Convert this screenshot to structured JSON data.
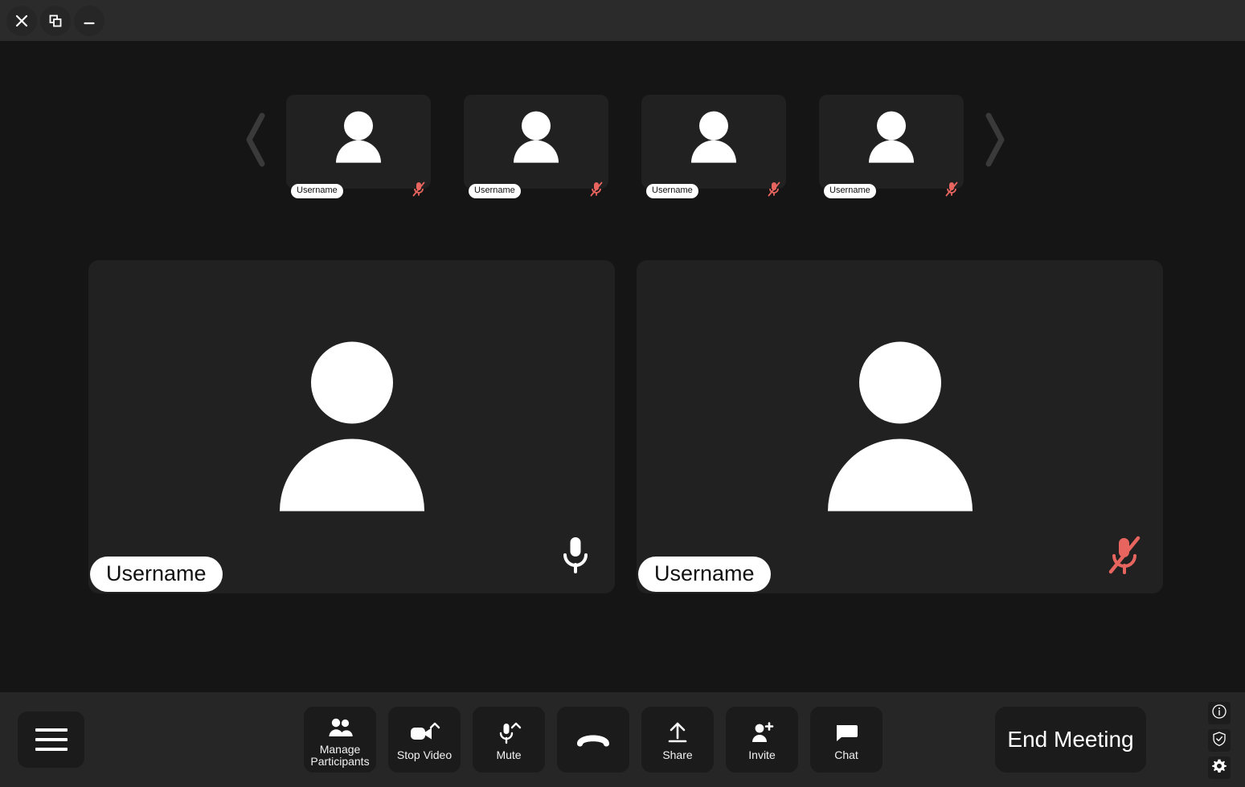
{
  "window": {
    "buttons": [
      {
        "name": "close",
        "icon": "close-icon"
      },
      {
        "name": "restore",
        "icon": "restore-window-icon"
      },
      {
        "name": "minimize",
        "icon": "minimize-icon"
      }
    ]
  },
  "colors": {
    "background": "#151515",
    "tile": "#212121",
    "toolbar": "#262626",
    "titlebar": "#2b2b2b",
    "button": "#1b1b1b",
    "muted_mic": "#e8655f",
    "text": "#ffffff",
    "pill_background": "#ffffff",
    "pill_text": "#111111",
    "chevron": "#3a3a3a"
  },
  "gallery": {
    "prev_label": "‹",
    "next_label": "›",
    "thumbnails": [
      {
        "username": "Username",
        "muted": true
      },
      {
        "username": "Username",
        "muted": true
      },
      {
        "username": "Username",
        "muted": true
      },
      {
        "username": "Username",
        "muted": true
      }
    ],
    "main_tiles": [
      {
        "username": "Username",
        "muted": false
      },
      {
        "username": "Username",
        "muted": true
      }
    ]
  },
  "toolbar": {
    "menu_label": "menu",
    "items": [
      {
        "label": "Manage\nParticipants",
        "icon": "participants-icon",
        "has_chevron": false
      },
      {
        "label": "Stop Video",
        "icon": "video-camera-icon",
        "has_chevron": true
      },
      {
        "label": "Mute",
        "icon": "microphone-icon",
        "has_chevron": true
      },
      {
        "label": "",
        "icon": "phone-handset-icon",
        "has_chevron": false
      },
      {
        "label": "Share",
        "icon": "share-upload-icon",
        "has_chevron": false
      },
      {
        "label": "Invite",
        "icon": "add-person-icon",
        "has_chevron": false
      },
      {
        "label": "Chat",
        "icon": "chat-bubble-icon",
        "has_chevron": false
      }
    ],
    "end_meeting_label": "End Meeting",
    "side_icons": [
      {
        "name": "info-icon"
      },
      {
        "name": "shield-check-icon"
      },
      {
        "name": "gear-icon"
      }
    ]
  }
}
